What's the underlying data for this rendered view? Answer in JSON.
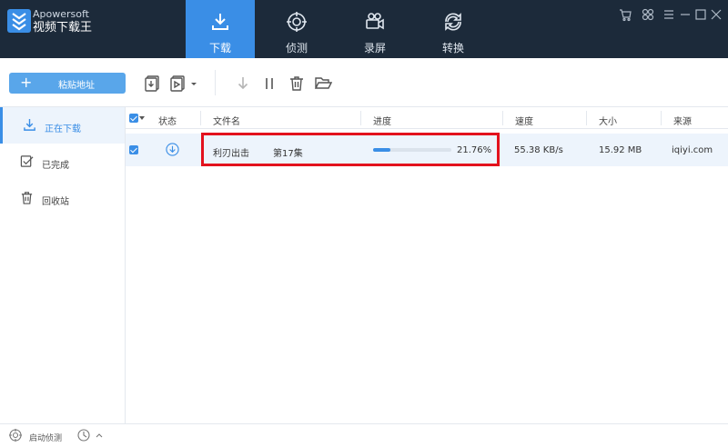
{
  "app": {
    "brand": "Apowersoft",
    "title": "视频下载王"
  },
  "nav": [
    {
      "label": "下载",
      "icon": "download-icon",
      "active": true
    },
    {
      "label": "侦测",
      "icon": "target-icon",
      "active": false
    },
    {
      "label": "录屏",
      "icon": "video-camera-icon",
      "active": false
    },
    {
      "label": "转换",
      "icon": "convert-icon",
      "active": false
    }
  ],
  "toolbar": {
    "paste_label": "粘贴地址"
  },
  "sidebar": [
    {
      "label": "正在下载",
      "icon": "download-icon",
      "active": true
    },
    {
      "label": "已完成",
      "icon": "check-icon",
      "active": false
    },
    {
      "label": "回收站",
      "icon": "trash-icon",
      "active": false
    }
  ],
  "table": {
    "headers": {
      "status": "状态",
      "filename": "文件名",
      "progress": "进度",
      "speed": "速度",
      "size": "大小",
      "source": "来源"
    },
    "rows": [
      {
        "title": "利刃出击",
        "episode": "第17集",
        "progress_text": "21.76%",
        "progress": 0.2176,
        "speed": "55.38 KB/s",
        "size": "15.92 MB",
        "source": "iqiyi.com"
      }
    ]
  },
  "status": {
    "detect_label": "启动侦测"
  },
  "colors": {
    "accent": "#3a8ee6",
    "titlebar": "#1c2a3a",
    "highlight": "#e3121d"
  }
}
